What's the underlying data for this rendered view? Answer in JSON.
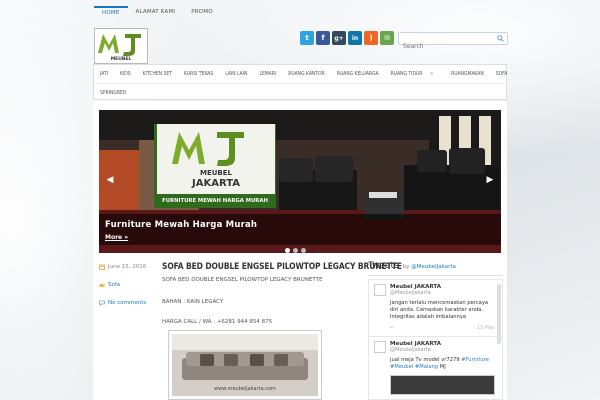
{
  "top_nav": [
    {
      "label": "HOME",
      "active": true
    },
    {
      "label": "ALAMAT KAMI"
    },
    {
      "label": "PROMO"
    }
  ],
  "logo": {
    "brand": "MEUBEL JAKARTA"
  },
  "social_icons": [
    {
      "name": "twitter",
      "glyph": "t",
      "color": "#2fa3e0"
    },
    {
      "name": "facebook",
      "glyph": "f",
      "color": "#3b5998"
    },
    {
      "name": "google-plus",
      "glyph": "g+",
      "color": "#34495e"
    },
    {
      "name": "linkedin",
      "glyph": "in",
      "color": "#0e76a8"
    },
    {
      "name": "rss",
      "glyph": ")",
      "color": "#f26522"
    },
    {
      "name": "email",
      "glyph": "✉",
      "color": "#68a54b"
    }
  ],
  "search": {
    "placeholder": "Search"
  },
  "categories_row1": [
    "JATI",
    "KIDS",
    "KITCHEN SET",
    "KURSI TERAS",
    "LAIN LAIN",
    "LEMARI",
    "RUANG KANTOR",
    "RUANG KELUARGA",
    "RUANG TIDUR",
    "RUANGMAKAN",
    "SOFA"
  ],
  "categories_row1_arrow": "»",
  "categories_row2": [
    "SPRINGBED"
  ],
  "slider": {
    "caption_title": "Furniture Mewah Harga Murah",
    "more_label": "More »",
    "sign_line1": "MEUBEL",
    "sign_line2": "JAKARTA",
    "sign_tagline": "FURNITURE MEWAH HARGA MURAH",
    "dots": 3,
    "active_dot": 1
  },
  "post": {
    "date": "June 15, 2016",
    "category": "Sofa",
    "comments": "No comments",
    "title": "SOFA BED DOUBLE ENGSEL PILOWTOP LEGACY BRUNETTE",
    "subtitle": "SOFA BED DOUBLE ENGSEL PILOWTOP LEGACY BRUNETTE",
    "material": "BAHAN : KAIN LEGACY",
    "price_call": "HARGA CALL / WA : +6281 944 854 875",
    "image_watermark": "www.meubeljakarta.com"
  },
  "tweets_widget": {
    "title": "Tweets",
    "by_prefix": "by",
    "by_handle": "@MeubelJakarta",
    "tweets": [
      {
        "name": "Meubel JAKARTA",
        "handle": "@MeubelJakarta",
        "text": "Jangan terlalu mencemaskan percaya diri anda. Cemaskan karakter anda. Integritas adalah imbalannya",
        "date": "13 May"
      },
      {
        "name": "Meubel JAKARTA",
        "handle": "@MeubelJakarta",
        "text_prefix": "jual meja Tv model vr7279 ",
        "tag1": "#Furniture",
        "tag2": "#Meubel",
        "tag3": "#Malang",
        "text_suffix": " MJ"
      }
    ]
  }
}
